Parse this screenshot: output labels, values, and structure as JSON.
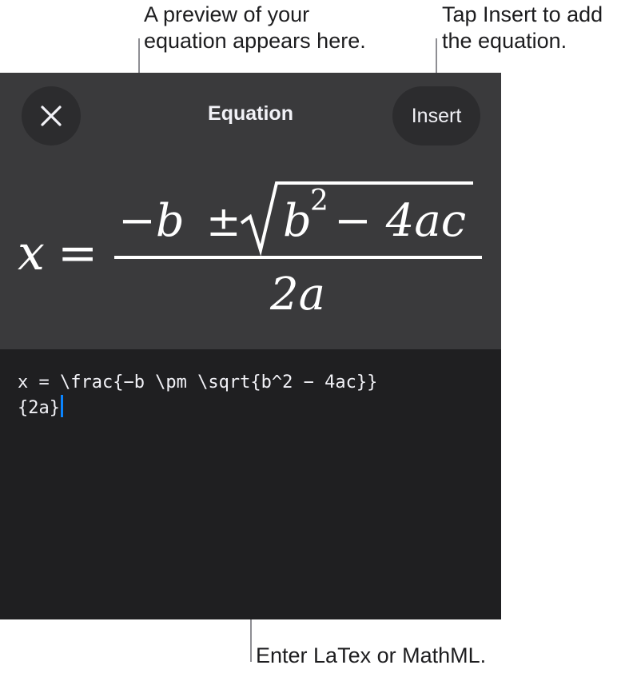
{
  "callouts": {
    "preview": "A preview of your\nequation appears here.",
    "insert": "Tap Insert to add\nthe equation.",
    "editor": "Enter LaTex or MathML."
  },
  "header": {
    "title": "Equation",
    "insert_label": "Insert",
    "close_icon": "xmark"
  },
  "preview": {
    "lhs": "x",
    "equals": "=",
    "numerator_minus_b": "−b",
    "plus_minus": "±",
    "radicand_b": "b",
    "exponent": "2",
    "radicand_rest": "− 4ac",
    "denominator": "2a"
  },
  "editor": {
    "line1": "x = \\frac{−b \\pm \\sqrt{b^2 − 4ac}}",
    "line2": "{2a}"
  },
  "colors": {
    "panel_top": "#3a3a3c",
    "panel_bottom": "#1f1f21",
    "button": "#2c2c2e",
    "caret": "#0a84ff"
  }
}
